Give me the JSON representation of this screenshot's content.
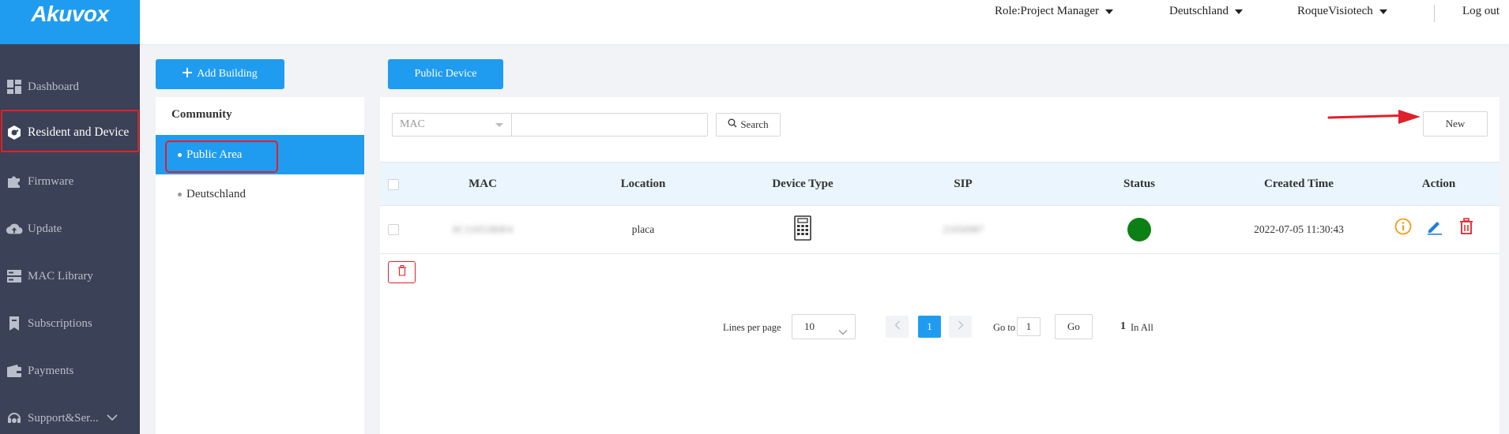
{
  "app": {
    "logo": "Akuvox"
  },
  "sidebar": {
    "items": [
      {
        "label": "Dashboard",
        "icon": "dashboard-icon"
      },
      {
        "label": "Resident and Device",
        "icon": "resident-device-icon",
        "active": true
      },
      {
        "label": "Firmware",
        "icon": "puzzle-icon"
      },
      {
        "label": "Update",
        "icon": "cloud-upload-icon"
      },
      {
        "label": "MAC Library",
        "icon": "server-icon"
      },
      {
        "label": "Subscriptions",
        "icon": "bookmark-icon"
      },
      {
        "label": "Payments",
        "icon": "wallet-icon"
      },
      {
        "label": "Support&Ser...",
        "icon": "headset-icon"
      }
    ]
  },
  "header": {
    "role": "Role:Project Manager",
    "language": "Deutschland",
    "user": "RoqueVisiotech",
    "logout": "Log out"
  },
  "buttons": {
    "add_building": "Add Building",
    "public_device": "Public Device"
  },
  "community": {
    "title": "Community",
    "items": [
      {
        "label": "Public Area",
        "selected": true
      },
      {
        "label": "Deutschland",
        "selected": false
      }
    ]
  },
  "filter": {
    "field": "MAC",
    "search_value": "",
    "search_label": "Search",
    "new_label": "New"
  },
  "table": {
    "columns": [
      "MAC",
      "Location",
      "Device Type",
      "SIP",
      "Status",
      "Created Time",
      "Action"
    ],
    "rows": [
      {
        "mac": "0C11051B0F4",
        "location": "placa",
        "device_type_icon": "intercom-device-icon",
        "sip": "21050987",
        "status_color": "#0c8014",
        "created_time": "2022-07-05 11:30:43"
      }
    ]
  },
  "pagination": {
    "lines_per_page_label": "Lines per page",
    "lines_per_page": "10",
    "current_page": "1",
    "goto_label": "Go to",
    "goto_value": "1",
    "go_label": "Go",
    "total_count": "1",
    "total_label": "In All"
  },
  "colors": {
    "accent": "#1f9cf0",
    "sidebar_bg": "#3b4156",
    "highlight": "#e0202a",
    "status_online": "#0c8014"
  }
}
